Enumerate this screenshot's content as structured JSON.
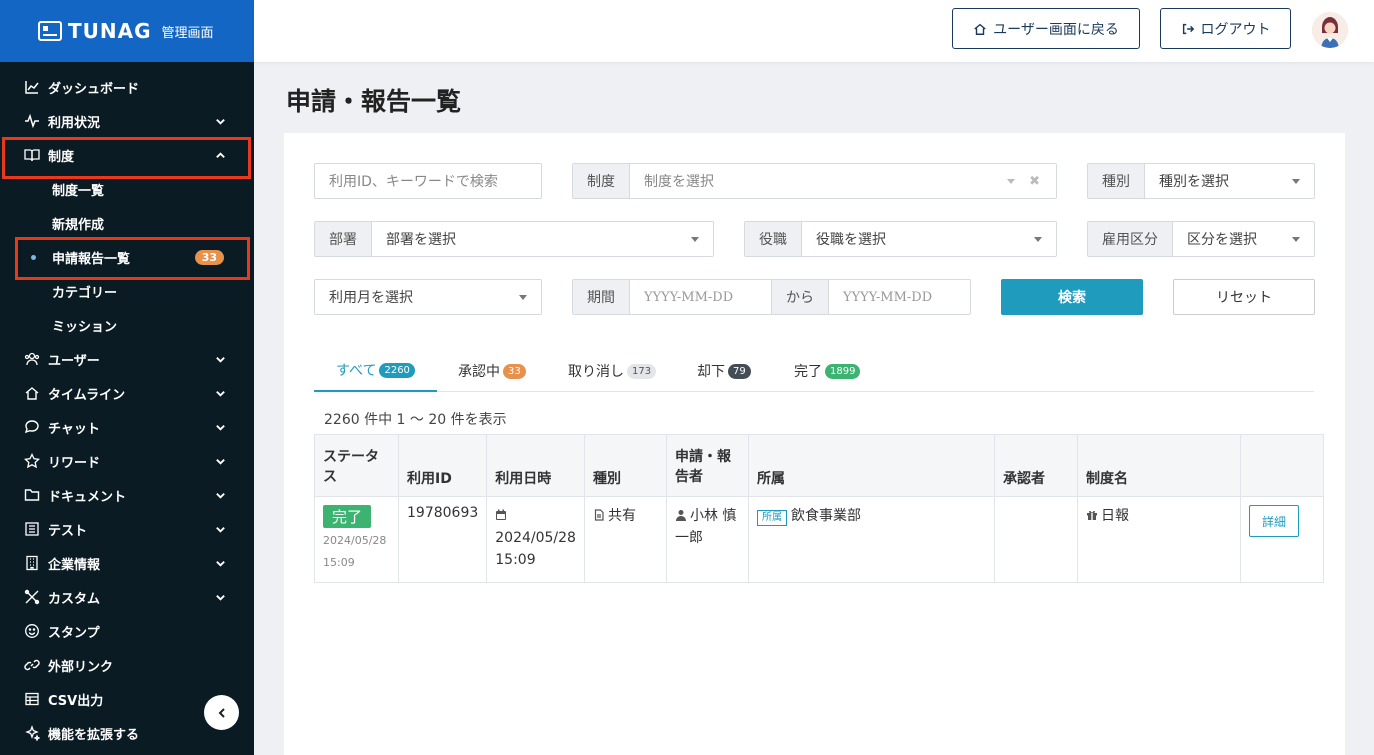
{
  "brand": {
    "name": "TUNAG",
    "sub": "管理画面"
  },
  "header": {
    "back_label": "ユーザー画面に戻る",
    "logout_label": "ログアウト"
  },
  "sidebar": {
    "items": [
      {
        "label": "ダッシュボード"
      },
      {
        "label": "利用状況"
      },
      {
        "label": "制度"
      },
      {
        "label": "ユーザー"
      },
      {
        "label": "タイムライン"
      },
      {
        "label": "チャット"
      },
      {
        "label": "リワード"
      },
      {
        "label": "ドキュメント"
      },
      {
        "label": "テスト"
      },
      {
        "label": "企業情報"
      },
      {
        "label": "カスタム"
      },
      {
        "label": "スタンプ"
      },
      {
        "label": "外部リンク"
      },
      {
        "label": "CSV出力"
      },
      {
        "label": "機能を拡張する"
      }
    ],
    "sub_items": [
      {
        "label": "制度一覧"
      },
      {
        "label": "新規作成"
      },
      {
        "label": "申請報告一覧",
        "count": "33"
      },
      {
        "label": "カテゴリー"
      },
      {
        "label": "ミッション"
      }
    ]
  },
  "page": {
    "title": "申請・報告一覧"
  },
  "filters": {
    "keyword_placeholder": "利用ID、キーワードで検索",
    "seido_label": "制度",
    "seido_placeholder": "制度を選択",
    "shubetsu_label": "種別",
    "shubetsu_placeholder": "種別を選択",
    "busho_label": "部署",
    "busho_placeholder": "部署を選択",
    "yakushoku_label": "役職",
    "yakushoku_placeholder": "役職を選択",
    "koyou_label": "雇用区分",
    "koyou_placeholder": "区分を選択",
    "month_placeholder": "利用月を選択",
    "period_label": "期間",
    "date_placeholder": "YYYY-MM-DD",
    "from_label": "から",
    "search_label": "検索",
    "reset_label": "リセット"
  },
  "tabs": [
    {
      "label": "すべて",
      "count": "2260",
      "color": "#1f9bbd"
    },
    {
      "label": "承認中",
      "count": "33",
      "color": "#e8914a"
    },
    {
      "label": "取り消し",
      "count": "173",
      "color": "#c8ccd2"
    },
    {
      "label": "却下",
      "count": "79",
      "color": "#444c55"
    },
    {
      "label": "完了",
      "count": "1899",
      "color": "#3cb371"
    }
  ],
  "result_summary": "2260 件中 1 〜 20 件を表示",
  "table": {
    "headers": [
      "ステータス",
      "利用ID",
      "利用日時",
      "種別",
      "申請・報告者",
      "所属",
      "承認者",
      "制度名",
      ""
    ],
    "rows": [
      {
        "status": "完了",
        "status_date": "2024/05/28",
        "status_time": "15:09",
        "id": "19780693",
        "date": "2024/05/28",
        "time": "15:09",
        "kind": "共有",
        "user": "小林 慎一郎",
        "affil_tag": "所属",
        "affil": "飲食事業部",
        "approver": "",
        "seido": "日報",
        "detail_label": "詳細"
      }
    ]
  }
}
